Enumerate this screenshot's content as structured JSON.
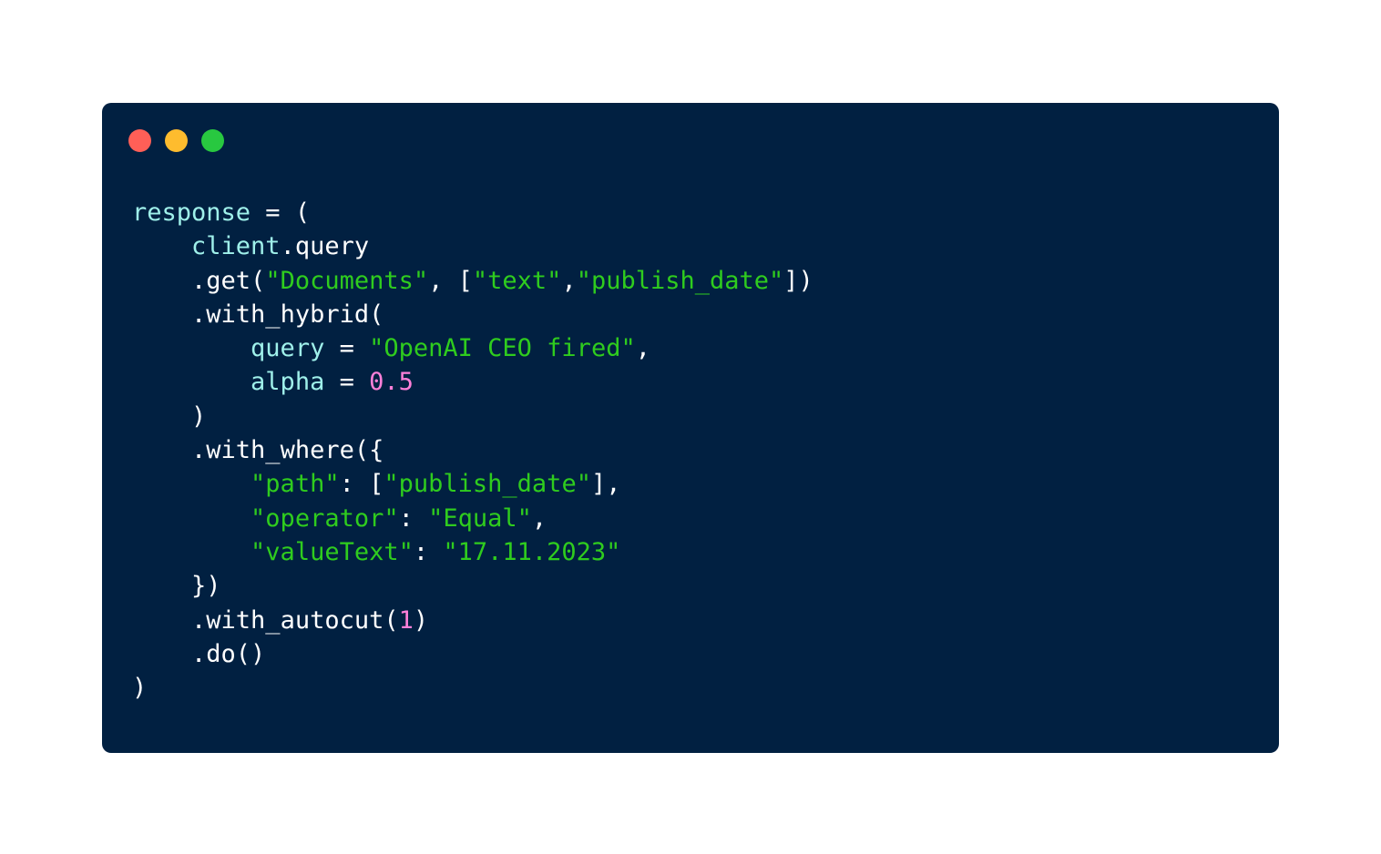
{
  "window": {
    "controls": [
      {
        "name": "close",
        "color": "#ff5f57"
      },
      {
        "name": "minimize",
        "color": "#febc2e"
      },
      {
        "name": "maximize",
        "color": "#28c840"
      }
    ]
  },
  "code": {
    "colors": {
      "ident": "#9ff0ea",
      "plain": "#ffffff",
      "string": "#2fcc1e",
      "number": "#ff80d9",
      "background": "#012041"
    },
    "lines": [
      {
        "indent": 0,
        "tokens": [
          {
            "t": "ident",
            "v": "response"
          },
          {
            "t": "plain",
            "v": " = ("
          }
        ]
      },
      {
        "indent": 1,
        "tokens": [
          {
            "t": "ident",
            "v": "client"
          },
          {
            "t": "plain",
            "v": ".query"
          }
        ]
      },
      {
        "indent": 1,
        "tokens": [
          {
            "t": "plain",
            "v": ".get("
          },
          {
            "t": "string",
            "v": "\"Documents\""
          },
          {
            "t": "plain",
            "v": ", ["
          },
          {
            "t": "string",
            "v": "\"text\""
          },
          {
            "t": "plain",
            "v": ","
          },
          {
            "t": "string",
            "v": "\"publish_date\""
          },
          {
            "t": "plain",
            "v": "])"
          }
        ]
      },
      {
        "indent": 1,
        "tokens": [
          {
            "t": "plain",
            "v": ".with_hybrid("
          }
        ]
      },
      {
        "indent": 2,
        "tokens": [
          {
            "t": "ident",
            "v": "query"
          },
          {
            "t": "plain",
            "v": " = "
          },
          {
            "t": "string",
            "v": "\"OpenAI CEO fired\""
          },
          {
            "t": "plain",
            "v": ","
          }
        ]
      },
      {
        "indent": 2,
        "tokens": [
          {
            "t": "ident",
            "v": "alpha"
          },
          {
            "t": "plain",
            "v": " = "
          },
          {
            "t": "number",
            "v": "0.5"
          }
        ]
      },
      {
        "indent": 1,
        "tokens": [
          {
            "t": "plain",
            "v": ")"
          }
        ]
      },
      {
        "indent": 1,
        "tokens": [
          {
            "t": "plain",
            "v": ".with_where({"
          }
        ]
      },
      {
        "indent": 2,
        "tokens": [
          {
            "t": "string",
            "v": "\"path\""
          },
          {
            "t": "plain",
            "v": ": ["
          },
          {
            "t": "string",
            "v": "\"publish_date\""
          },
          {
            "t": "plain",
            "v": "],"
          }
        ]
      },
      {
        "indent": 2,
        "tokens": [
          {
            "t": "string",
            "v": "\"operator\""
          },
          {
            "t": "plain",
            "v": ": "
          },
          {
            "t": "string",
            "v": "\"Equal\""
          },
          {
            "t": "plain",
            "v": ","
          }
        ]
      },
      {
        "indent": 2,
        "tokens": [
          {
            "t": "string",
            "v": "\"valueText\""
          },
          {
            "t": "plain",
            "v": ": "
          },
          {
            "t": "string",
            "v": "\"17.11.2023\""
          }
        ]
      },
      {
        "indent": 1,
        "tokens": [
          {
            "t": "plain",
            "v": "})"
          }
        ]
      },
      {
        "indent": 1,
        "tokens": [
          {
            "t": "plain",
            "v": ".with_autocut("
          },
          {
            "t": "number",
            "v": "1"
          },
          {
            "t": "plain",
            "v": ")"
          }
        ]
      },
      {
        "indent": 1,
        "tokens": [
          {
            "t": "plain",
            "v": ".do()"
          }
        ]
      },
      {
        "indent": 0,
        "tokens": [
          {
            "t": "plain",
            "v": ")"
          }
        ]
      }
    ]
  }
}
